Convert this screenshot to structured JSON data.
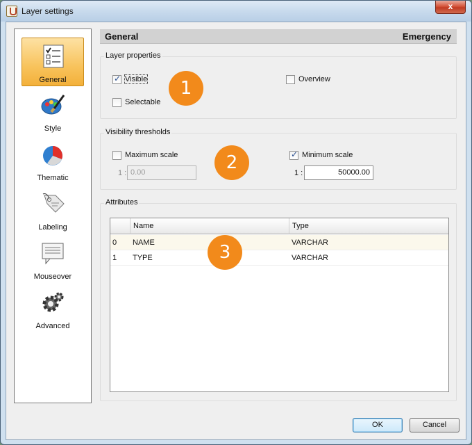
{
  "window": {
    "title": "Layer settings",
    "close_glyph": "x"
  },
  "nav": {
    "items": [
      {
        "label": "General",
        "icon": "checklist-icon",
        "selected": true
      },
      {
        "label": "Style",
        "icon": "palette-brush-icon",
        "selected": false
      },
      {
        "label": "Thematic",
        "icon": "pie-chart-icon",
        "selected": false
      },
      {
        "label": "Labeling",
        "icon": "label-tag-icon",
        "selected": false
      },
      {
        "label": "Mouseover",
        "icon": "tooltip-icon",
        "selected": false
      },
      {
        "label": "Advanced",
        "icon": "gear-icon",
        "selected": false
      }
    ]
  },
  "header": {
    "title": "General",
    "layer_name": "Emergency"
  },
  "layer_properties": {
    "title": "Layer properties",
    "visible": {
      "label": "Visible",
      "checked": true
    },
    "selectable": {
      "label": "Selectable",
      "checked": false
    },
    "overview": {
      "label": "Overview",
      "checked": false
    }
  },
  "visibility_thresholds": {
    "title": "Visibility thresholds",
    "max_scale": {
      "label": "Maximum scale",
      "checked": false,
      "prefix": "1 :",
      "value": "0.00"
    },
    "min_scale": {
      "label": "Minimum scale",
      "checked": true,
      "prefix": "1 :",
      "value": "50000.00"
    }
  },
  "attributes": {
    "title": "Attributes",
    "columns": [
      "",
      "Name",
      "Type"
    ],
    "rows": [
      {
        "index": "0",
        "name": "NAME",
        "type": "VARCHAR"
      },
      {
        "index": "1",
        "name": "TYPE",
        "type": "VARCHAR"
      }
    ]
  },
  "badges": [
    "1",
    "2",
    "3"
  ],
  "buttons": {
    "ok": "OK",
    "cancel": "Cancel"
  },
  "colors": {
    "badge": "#f28a1b",
    "selected_nav": "#f8c35c",
    "header_band": "#d2d2d2"
  }
}
